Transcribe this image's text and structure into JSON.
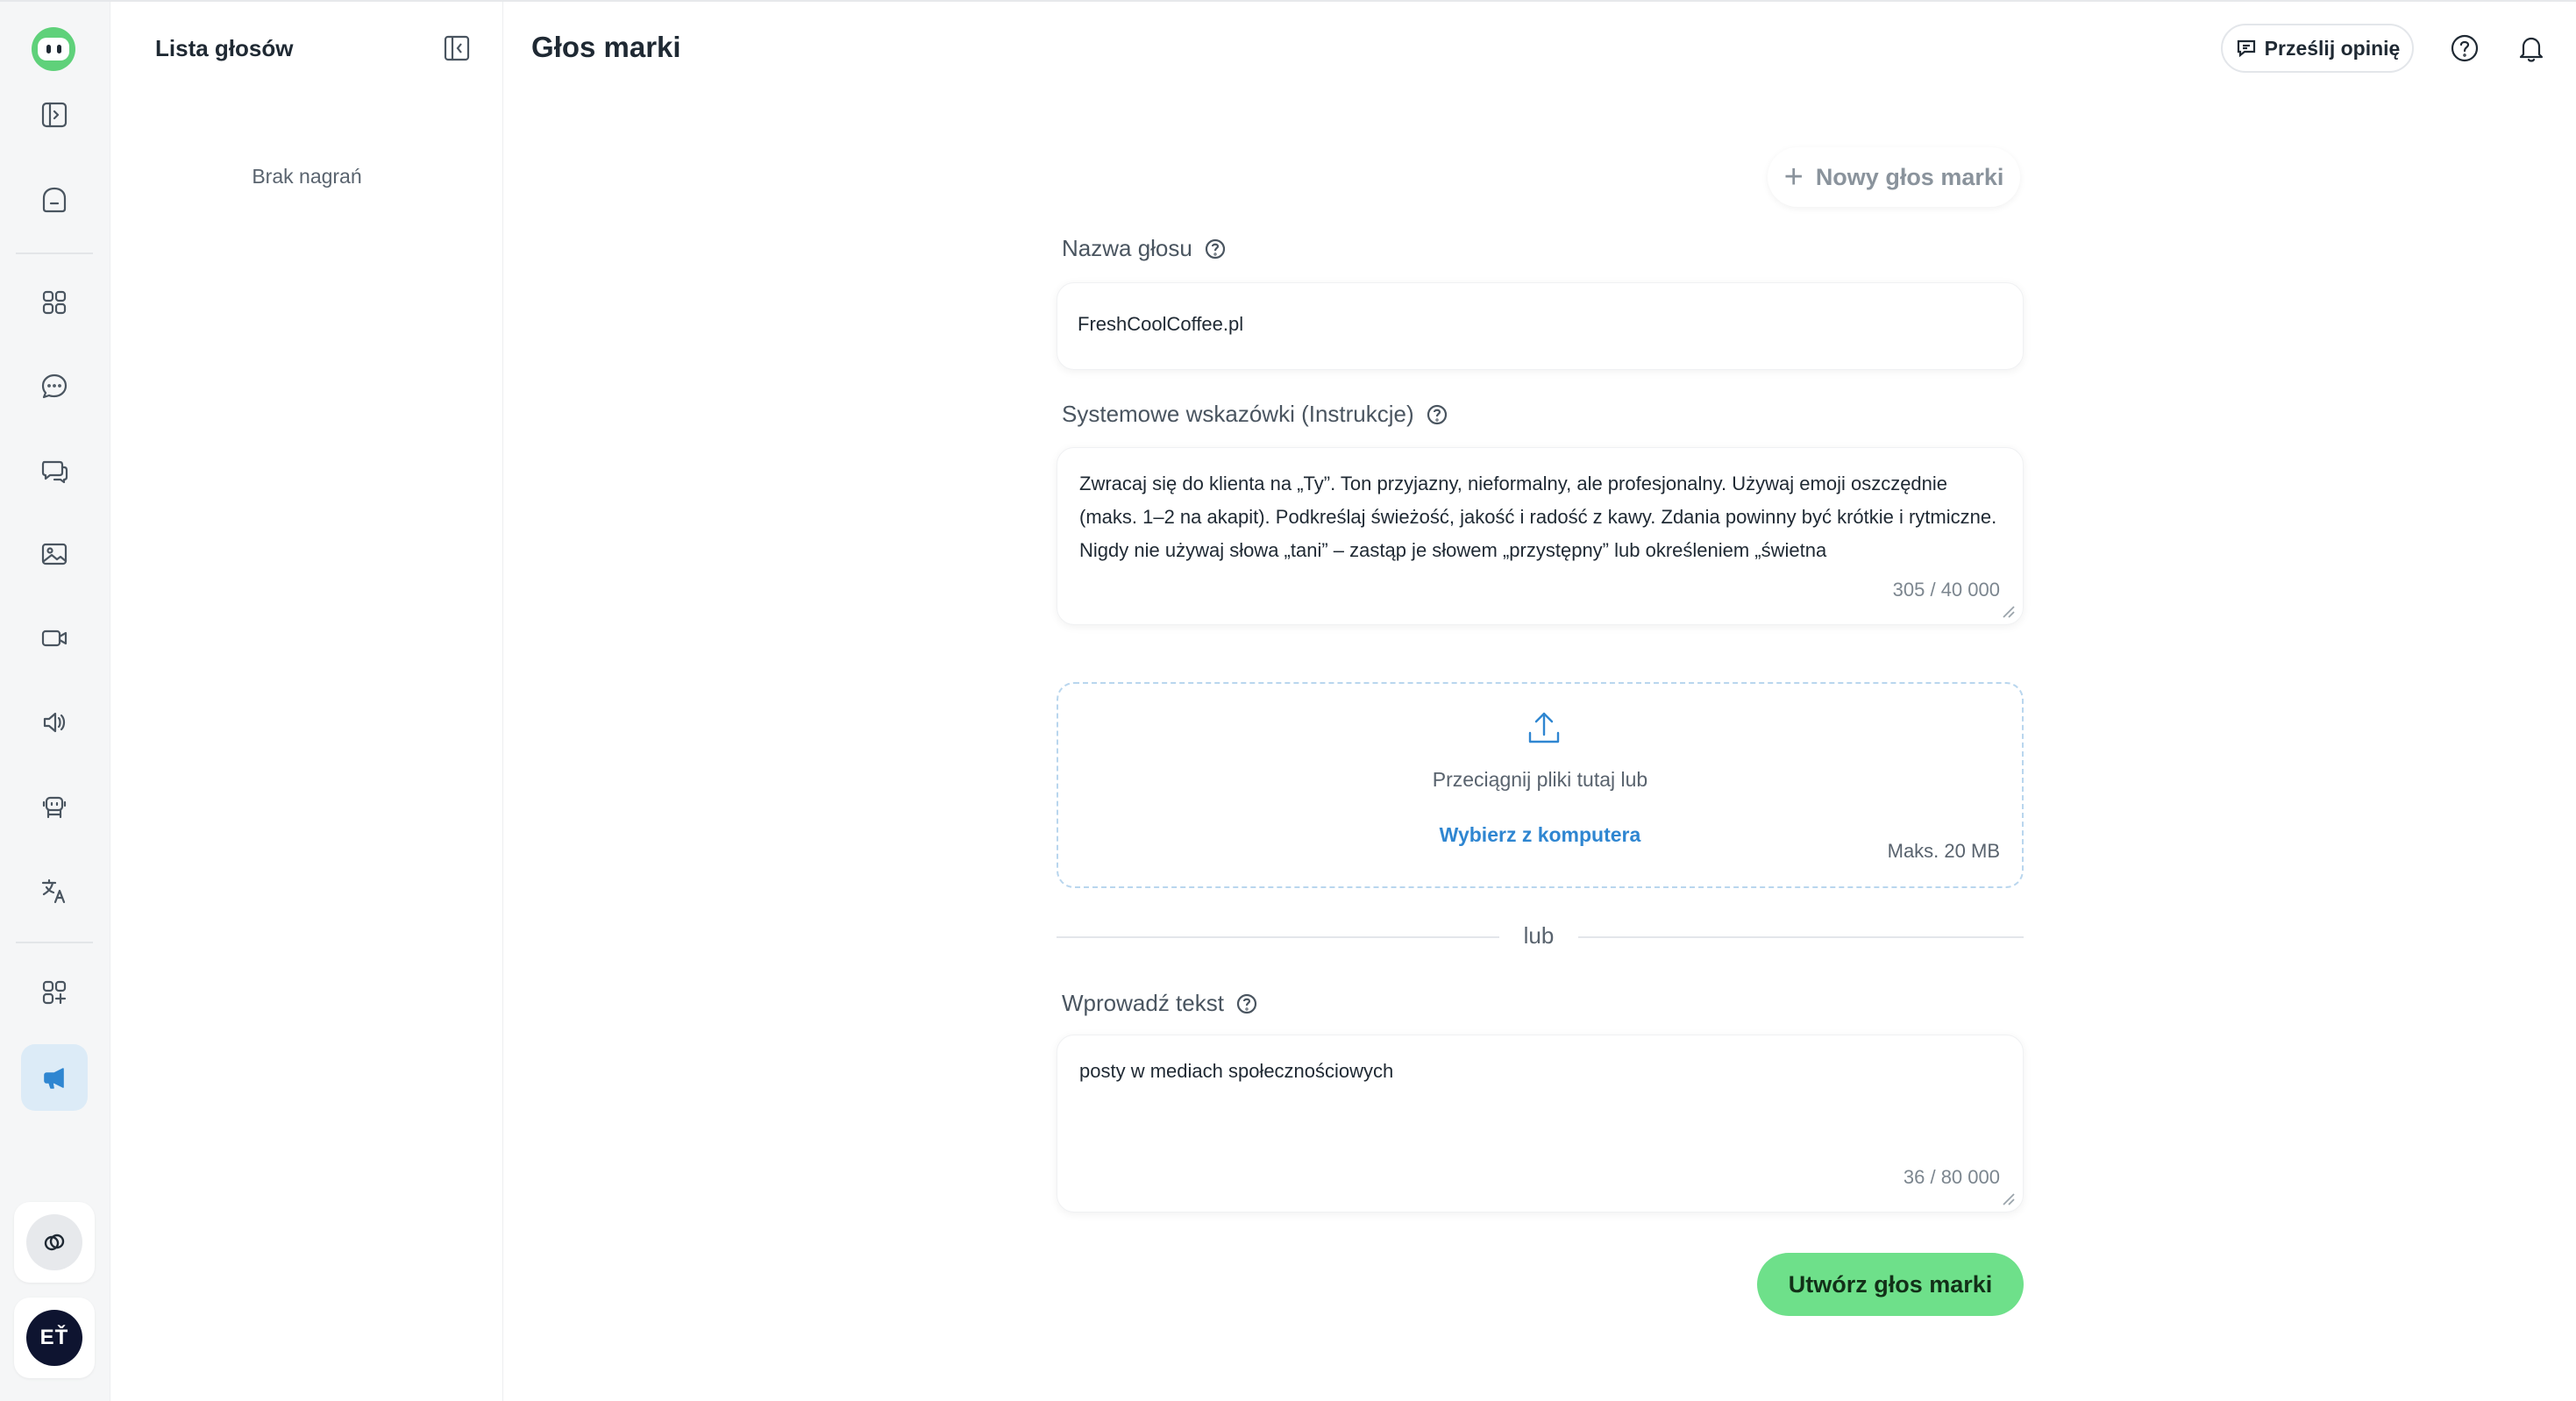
{
  "app": {
    "accent": "#6ee08a",
    "link_color": "#2f86d1"
  },
  "rail": {
    "items": [
      {
        "icon": "sidebar-toggle-icon"
      },
      {
        "icon": "home-icon"
      },
      {
        "icon": "apps-grid-icon"
      },
      {
        "icon": "chat-icon"
      },
      {
        "icon": "chats-icon"
      },
      {
        "icon": "image-icon"
      },
      {
        "icon": "video-icon"
      },
      {
        "icon": "speaker-icon"
      },
      {
        "icon": "robot-icon"
      },
      {
        "icon": "translate-icon"
      },
      {
        "icon": "add-apps-icon"
      },
      {
        "icon": "megaphone-icon",
        "active": true
      }
    ],
    "avatar_initials": "EŤ"
  },
  "list_panel": {
    "title": "Lista głosów",
    "empty_text": "Brak nagrań"
  },
  "header": {
    "title": "Głos marki",
    "feedback_label": "Prześlij opinię"
  },
  "form": {
    "new_voice_label": "Nowy głos marki",
    "name_label": "Nazwa głosu",
    "name_value": "FreshCoolCoffee.pl",
    "instructions_label": "Systemowe wskazówki (Instrukcje)",
    "instructions_value": "Zwracaj się do klienta na „Ty”. Ton przyjazny, nieformalny, ale profesjonalny. Używaj emoji oszczędnie (maks. 1–2 na akapit). Podkreślaj świeżość, jakość i radość z kawy. Zdania powinny być krótkie i rytmiczne. Nigdy nie używaj słowa „tani” – zastąp je słowem „przystępny” lub określeniem „świetna",
    "instructions_counter": "305 / 40 000",
    "dropzone_text": "Przeciągnij pliki tutaj lub",
    "dropzone_link": "Wybierz z komputera",
    "dropzone_max": "Maks. 20 MB",
    "or_text": "lub",
    "text_label": "Wprowadź tekst",
    "text_value": "posty w mediach społecznościowych",
    "text_counter": "36 / 80 000",
    "submit_label": "Utwórz głos marki"
  }
}
